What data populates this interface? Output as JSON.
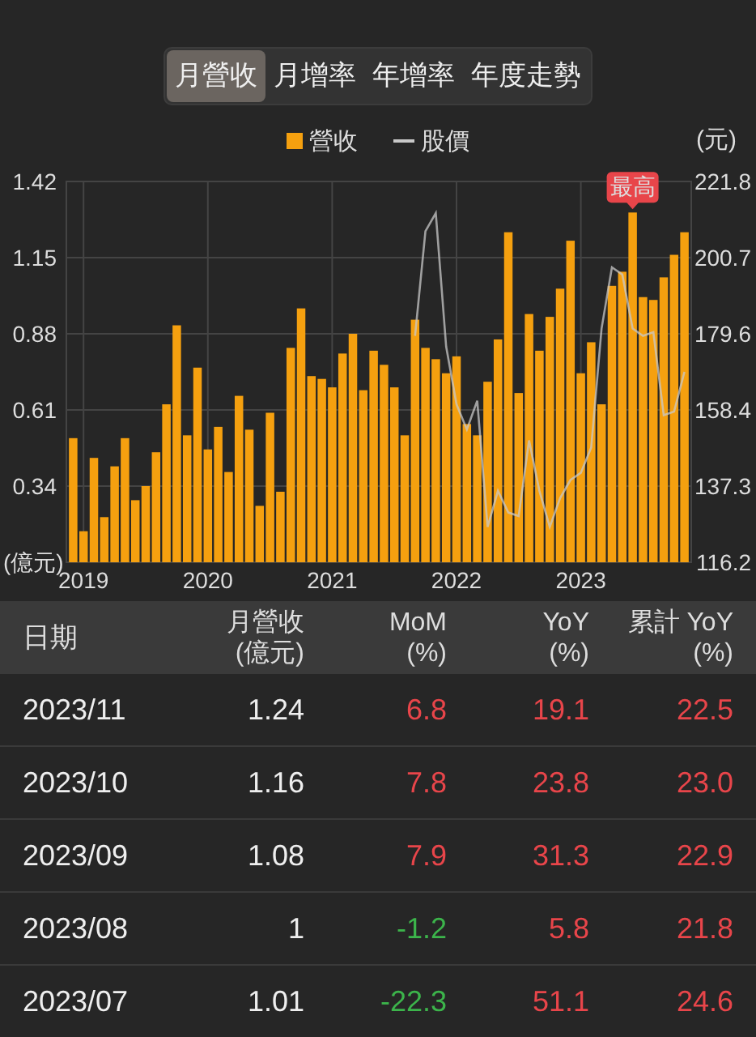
{
  "tabs": [
    {
      "label": "月營收",
      "selected": true
    },
    {
      "label": "月增率",
      "selected": false
    },
    {
      "label": "年增率",
      "selected": false
    },
    {
      "label": "年度走勢",
      "selected": false
    }
  ],
  "chart": {
    "chart_data": {
      "type": "bar",
      "ylabel": "(億元)",
      "y2label": "(元)",
      "categories": [
        null,
        "2019",
        null,
        null,
        null,
        null,
        null,
        null,
        null,
        null,
        null,
        null,
        null,
        "2020",
        null,
        null,
        null,
        null,
        null,
        null,
        null,
        null,
        null,
        null,
        null,
        "2021",
        null,
        null,
        null,
        null,
        null,
        null,
        null,
        null,
        null,
        null,
        null,
        "2022",
        null,
        null,
        null,
        null,
        null,
        null,
        null,
        null,
        null,
        null,
        null,
        "2023",
        null,
        null,
        null,
        null,
        null,
        null,
        null,
        null,
        null,
        null
      ],
      "series": [
        {
          "name": "營收",
          "color": "#f5a00f",
          "values": [
            0.51,
            0.18,
            0.44,
            0.23,
            0.41,
            0.51,
            0.29,
            0.34,
            0.46,
            0.63,
            0.91,
            0.52,
            0.76,
            0.47,
            0.55,
            0.39,
            0.66,
            0.54,
            0.27,
            0.6,
            0.32,
            0.83,
            0.97,
            0.73,
            0.72,
            0.69,
            0.81,
            0.88,
            0.68,
            0.82,
            0.77,
            0.69,
            0.52,
            0.93,
            0.83,
            0.79,
            0.74,
            0.8,
            0.56,
            0.52,
            0.71,
            0.86,
            1.24,
            0.67,
            0.95,
            0.82,
            0.94,
            1.04,
            1.21,
            0.74,
            0.85,
            0.63,
            1.05,
            1.1,
            1.31,
            1.01,
            1.0,
            1.08,
            1.16,
            1.24
          ]
        },
        {
          "name": "股價",
          "color": "#c8c8c8",
          "type": "line",
          "axis": "y2",
          "values": [
            null,
            null,
            null,
            null,
            null,
            null,
            null,
            null,
            null,
            null,
            null,
            null,
            null,
            null,
            null,
            null,
            null,
            null,
            null,
            null,
            null,
            null,
            null,
            null,
            null,
            null,
            null,
            null,
            null,
            null,
            null,
            null,
            null,
            179,
            208,
            213,
            176,
            160,
            153,
            161,
            126,
            136,
            130,
            129,
            150,
            136,
            126,
            134,
            139,
            141,
            148,
            181,
            198,
            196,
            181,
            179,
            180,
            157,
            158,
            169
          ]
        }
      ],
      "ylim": [
        0.07,
        1.42
      ],
      "yticks": [
        0.34,
        0.61,
        0.88,
        1.15,
        1.42
      ],
      "y2lim": [
        116.2,
        221.8
      ],
      "y2ticks": [
        116.2,
        137.3,
        158.4,
        179.6,
        200.7,
        221.8
      ],
      "grid": true,
      "annotations": [
        {
          "text": "最高"
        }
      ]
    }
  },
  "table": {
    "columns": [
      {
        "title": "日期"
      },
      {
        "title": "月營收",
        "unit": "(億元)"
      },
      {
        "title": "MoM",
        "unit": "(%)"
      },
      {
        "title": "YoY",
        "unit": "(%)"
      },
      {
        "title": "累計 YoY",
        "unit": "(%)"
      }
    ],
    "rows": [
      {
        "date": "2023/11",
        "revenue": "1.24",
        "changes": [
          {
            "text": "6.8",
            "color": "#e8454a"
          },
          {
            "text": "19.1",
            "color": "#e8454a"
          },
          {
            "text": "22.5",
            "color": "#e8454a"
          }
        ]
      },
      {
        "date": "2023/10",
        "revenue": "1.16",
        "changes": [
          {
            "text": "7.8",
            "color": "#e8454a"
          },
          {
            "text": "23.8",
            "color": "#e8454a"
          },
          {
            "text": "23.0",
            "color": "#e8454a"
          }
        ]
      },
      {
        "date": "2023/09",
        "revenue": "1.08",
        "changes": [
          {
            "text": "7.9",
            "color": "#e8454a"
          },
          {
            "text": "31.3",
            "color": "#e8454a"
          },
          {
            "text": "22.9",
            "color": "#e8454a"
          }
        ]
      },
      {
        "date": "2023/08",
        "revenue": "1",
        "changes": [
          {
            "text": "-1.2",
            "color": "#3cb44b"
          },
          {
            "text": "5.8",
            "color": "#e8454a"
          },
          {
            "text": "21.8",
            "color": "#e8454a"
          }
        ]
      },
      {
        "date": "2023/07",
        "revenue": "1.01",
        "changes": [
          {
            "text": "-22.3",
            "color": "#3cb44b"
          },
          {
            "text": "51.1",
            "color": "#e8454a"
          },
          {
            "text": "24.6",
            "color": "#e8454a"
          }
        ]
      }
    ]
  }
}
